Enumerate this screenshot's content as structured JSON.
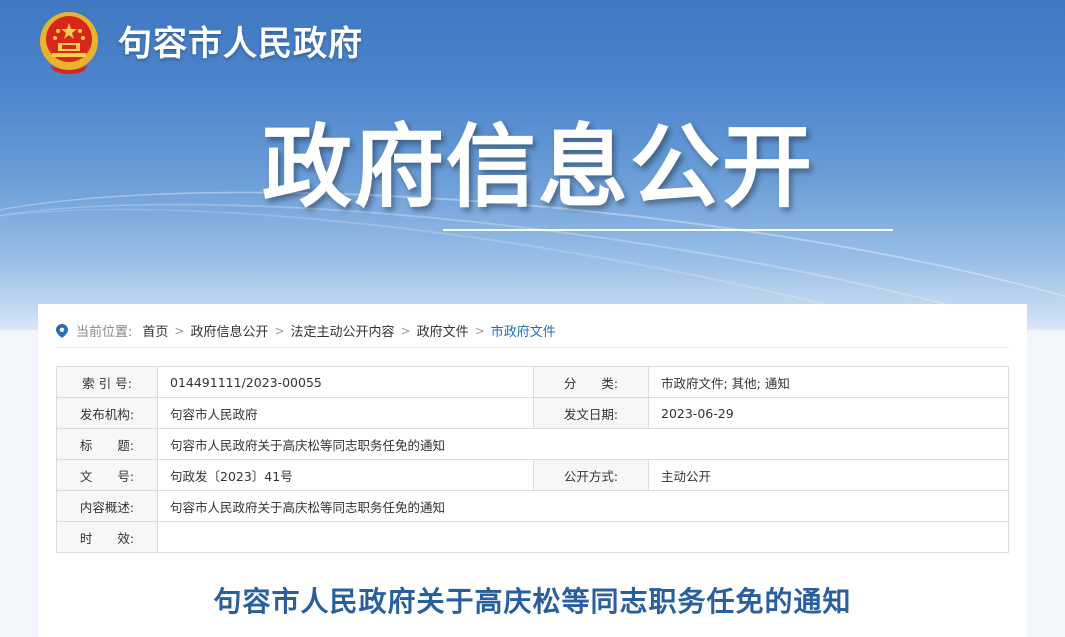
{
  "header": {
    "site_title": "句容市人民政府",
    "hero_title": "政府信息公开"
  },
  "breadcrumb": {
    "label": "当前位置:",
    "items": [
      "首页",
      "政府信息公开",
      "法定主动公开内容",
      "政府文件",
      "市政府文件"
    ],
    "separator": ">"
  },
  "meta": {
    "index_no_label": "索 引 号:",
    "index_no": "014491111/2023-00055",
    "category_label": "分　　类:",
    "category": "市政府文件; 其他; 通知",
    "issuer_label": "发布机构:",
    "issuer": "句容市人民政府",
    "date_label": "发文日期:",
    "date": "2023-06-29",
    "title_label": "标　　题:",
    "title": "句容市人民政府关于高庆松等同志职务任免的通知",
    "doc_no_label": "文　　号:",
    "doc_no": "句政发〔2023〕41号",
    "public_mode_label": "公开方式:",
    "public_mode": "主动公开",
    "summary_label": "内容概述:",
    "summary": "句容市人民政府关于高庆松等同志职务任免的通知",
    "validity_label": "时　　效:",
    "validity": ""
  },
  "document": {
    "title": "句容市人民政府关于高庆松等同志职务任免的通知"
  },
  "colors": {
    "banner_top": "#3f78c1",
    "link_active": "#1f6fc1",
    "doc_title": "#2a5f9e"
  },
  "icons": [
    "national-emblem-icon",
    "location-pin-icon"
  ]
}
